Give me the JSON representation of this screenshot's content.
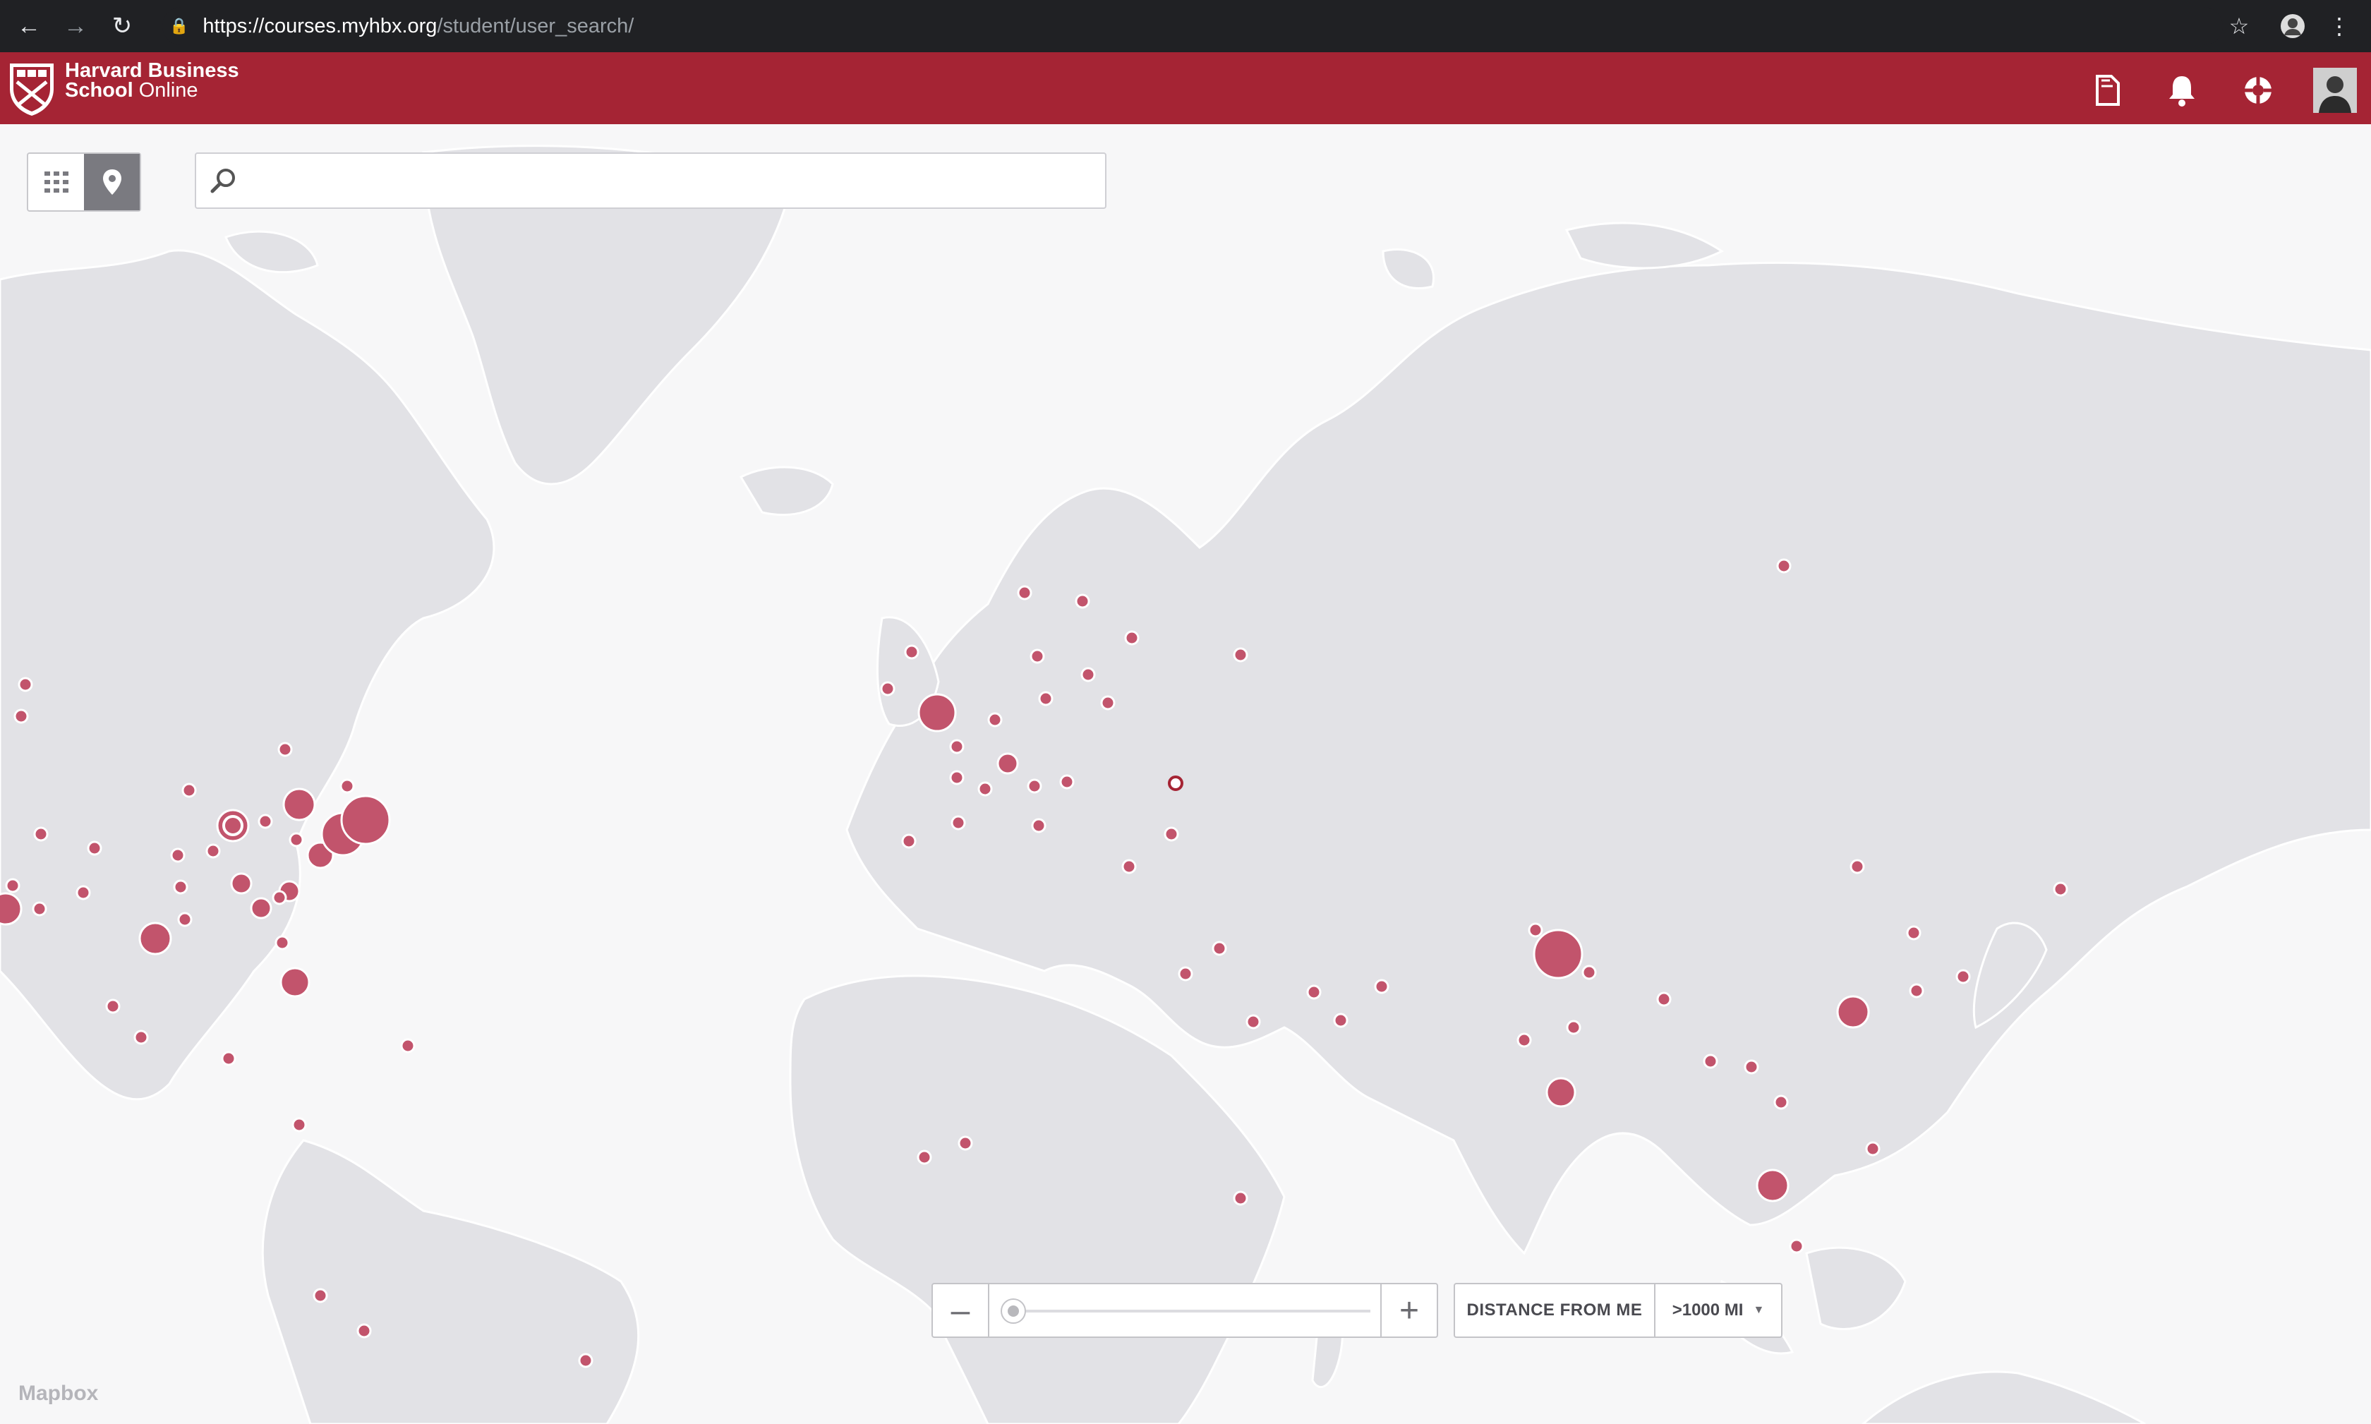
{
  "browser": {
    "url_host": "https://courses.myhbx.org",
    "url_path": "/student/user_search/"
  },
  "header": {
    "brand_line1": "Harvard Business",
    "brand_line2_bold": "School",
    "brand_line2_light": " Online",
    "icons": [
      "document-icon",
      "bell-icon",
      "help-icon",
      "user-avatar"
    ]
  },
  "search": {
    "value": "",
    "placeholder": ""
  },
  "view_toggle": {
    "options": [
      "grid-view",
      "map-view"
    ],
    "active": "map-view"
  },
  "map_controls": {
    "zoom_out": "–",
    "zoom_in": "+",
    "zoom_level": 0,
    "distance_label": "DISTANCE FROM ME",
    "distance_value": ">1000 MI"
  },
  "attribution": "Mapbox",
  "colors": {
    "brand": "#a52434",
    "marker": "#c2546c",
    "land": "#e2e2e6",
    "water": "#f7f7f8"
  }
}
